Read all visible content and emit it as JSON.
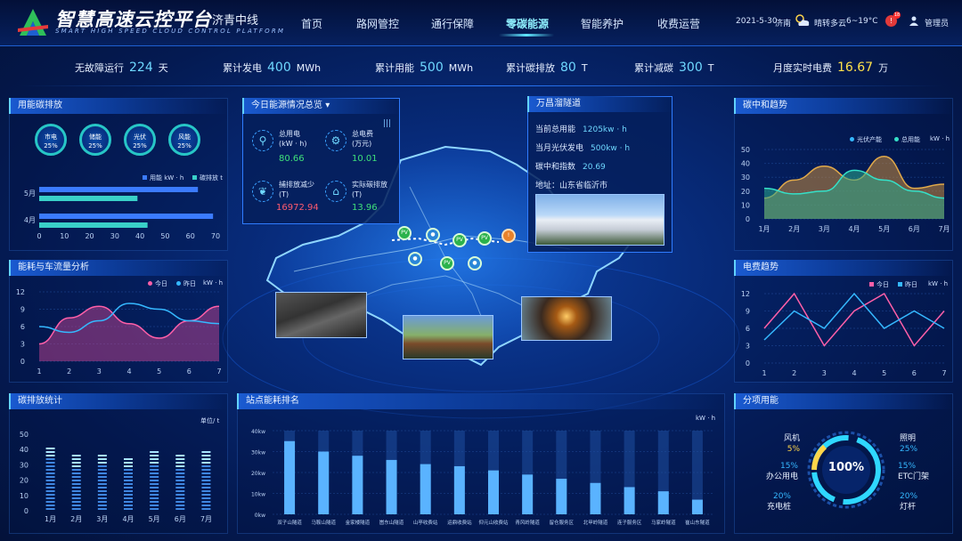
{
  "header": {
    "title": "智慧高速云控平台",
    "subtitle": "济青中线",
    "en_title": "SMART HIGH SPEED CLOUD CONTROL PLATFORM",
    "nav": [
      "首页",
      "路网管控",
      "通行保障",
      "零碳能源",
      "智能养护",
      "收费运营"
    ],
    "active_nav": "零碳能源",
    "date": "2021-5-30",
    "city": "济南",
    "weather": "晴转多云",
    "temp": "6~19°C",
    "alert_count": "18",
    "user": "管理员"
  },
  "stats": [
    {
      "label": "无故障运行",
      "value": "224",
      "unit": "天"
    },
    {
      "label": "累计发电",
      "value": "400",
      "unit": "MWh"
    },
    {
      "label": "累计用能",
      "value": "500",
      "unit": "MWh"
    },
    {
      "label": "累计碳排放",
      "value": "80",
      "unit": "T"
    },
    {
      "label": "累计减碳",
      "value": "300",
      "unit": "T"
    },
    {
      "label": "月度实时电费",
      "value": "16.67",
      "unit": "万"
    }
  ],
  "carbon_use": {
    "title": "用能碳排放",
    "rings": [
      {
        "label": "市电",
        "pct": "25%"
      },
      {
        "label": "储能",
        "pct": "25%"
      },
      {
        "label": "光伏",
        "pct": "25%"
      },
      {
        "label": "风能",
        "pct": "25%"
      }
    ],
    "legend": [
      "用能 kW · h",
      "碳排放 t"
    ],
    "chart_data": {
      "type": "bar",
      "categories": [
        "5月",
        "4月"
      ],
      "series": [
        {
          "name": "用能 kW · h",
          "values": [
            63,
            69
          ]
        },
        {
          "name": "碳排放 t",
          "values": [
            39,
            43
          ]
        }
      ],
      "xticks": [
        "0",
        "10",
        "20",
        "30",
        "40",
        "50",
        "60",
        "70"
      ],
      "xlim": [
        0,
        70
      ]
    }
  },
  "energy_flow": {
    "title": "能耗与车流量分析",
    "legend": [
      "今日",
      "昨日",
      "kW · h"
    ],
    "chart_data": {
      "type": "line",
      "x": [
        1,
        2,
        3,
        4,
        5,
        6,
        7
      ],
      "ylim": [
        0,
        12
      ],
      "yticks": [
        "12",
        "9",
        "6",
        "3",
        "0"
      ],
      "xticks": [
        "1",
        "2",
        "3",
        "4",
        "5",
        "6",
        "7"
      ],
      "series": [
        {
          "name": "今日",
          "values": [
            3,
            7.5,
            9.5,
            6.5,
            4,
            7,
            9.5
          ]
        },
        {
          "name": "昨日",
          "values": [
            6,
            5,
            7,
            10,
            9,
            7,
            6.5
          ]
        }
      ]
    }
  },
  "carbon_stats": {
    "title": "碳排放统计",
    "unit": "单位/ t",
    "chart_data": {
      "type": "bar",
      "categories": [
        "1月",
        "2月",
        "3月",
        "4月",
        "5月",
        "6月",
        "7月"
      ],
      "values": [
        43,
        37,
        38,
        36,
        40,
        37,
        40
      ],
      "ylim": [
        0,
        50
      ],
      "yticks": [
        "50",
        "40",
        "30",
        "20",
        "10",
        "0"
      ]
    }
  },
  "today_energy": {
    "title": "今日能源情况总览",
    "items": [
      {
        "label": "总用电\n(kW · h)",
        "value": "80.66",
        "color": "#3fe07a"
      },
      {
        "label": "总电费\n(万元)",
        "value": "10.01",
        "color": "#3fe07a"
      },
      {
        "label": "捕排放减少\n(T)",
        "value": "16972.94",
        "color": "#ff5a6e"
      },
      {
        "label": "实际碳排放\n(T)",
        "value": "13.96",
        "color": "#3fe07a"
      }
    ]
  },
  "tunnel": {
    "title": "万昌溜隧道",
    "rows": [
      {
        "label": "当前总用能",
        "value": "1205kw · h"
      },
      {
        "label": "当月光伏发电",
        "value": "500kw · h"
      },
      {
        "label": "碳中和指数",
        "value": "20.69"
      }
    ],
    "address": "地址：山东省临沂市"
  },
  "neutral_trend": {
    "title": "碳中和趋势",
    "legend": [
      "光伏产能",
      "总用能",
      "kW · h"
    ],
    "chart_data": {
      "type": "area",
      "x": [
        "1月",
        "2月",
        "3月",
        "4月",
        "5月",
        "6月",
        "7月"
      ],
      "ylim": [
        0,
        50
      ],
      "yticks": [
        "50",
        "40",
        "30",
        "20",
        "10",
        "0"
      ],
      "series": [
        {
          "name": "光伏产能",
          "values": [
            15,
            28,
            38,
            28,
            45,
            22,
            25
          ]
        },
        {
          "name": "总用能",
          "values": [
            22,
            18,
            20,
            35,
            28,
            20,
            15
          ]
        }
      ]
    }
  },
  "fee_trend": {
    "title": "电费趋势",
    "legend": [
      "今日",
      "昨日",
      "kW · h"
    ],
    "chart_data": {
      "type": "line",
      "x": [
        1,
        2,
        3,
        4,
        5,
        6,
        7
      ],
      "ylim": [
        0,
        12
      ],
      "yticks": [
        "12",
        "9",
        "6",
        "3",
        "0"
      ],
      "xticks": [
        "1",
        "2",
        "3",
        "4",
        "5",
        "6",
        "7"
      ],
      "series": [
        {
          "name": "今日",
          "values": [
            6,
            12,
            3,
            9,
            12,
            3,
            9
          ]
        },
        {
          "name": "昨日",
          "values": [
            4,
            9,
            6,
            12,
            6,
            9,
            6
          ]
        }
      ]
    }
  },
  "station_rank": {
    "title": "站点能耗排名",
    "unit": "kW · h",
    "chart_data": {
      "type": "bar",
      "categories": [
        "双子山隧道",
        "马鞍山隧道",
        "金家楼隧道",
        "崮东山隧道",
        "山亭收费站",
        "运鼎收费站",
        "仰元山收费站",
        "青风岭隧道",
        "留仓服务区",
        "北甲岭隧道",
        "连子服务区",
        "马家岭隧道",
        "崔山东隧道"
      ],
      "values": [
        35,
        30,
        28,
        26,
        24,
        23,
        21,
        19,
        17,
        15,
        13,
        11,
        7
      ],
      "ylim": [
        0,
        40
      ],
      "yticks": [
        "40kw",
        "30kw",
        "20kw",
        "10kw",
        "0kw"
      ]
    }
  },
  "sub_energy": {
    "title": "分项用能",
    "center": "100%",
    "items": [
      {
        "name": "风机",
        "pct": "5%"
      },
      {
        "name": "照明",
        "pct": "25%"
      },
      {
        "name": "办公用电",
        "pct": "15%"
      },
      {
        "name": "ETC门架",
        "pct": "15%"
      },
      {
        "name": "充电桩",
        "pct": "20%"
      },
      {
        "name": "灯杆",
        "pct": "20%"
      }
    ]
  }
}
